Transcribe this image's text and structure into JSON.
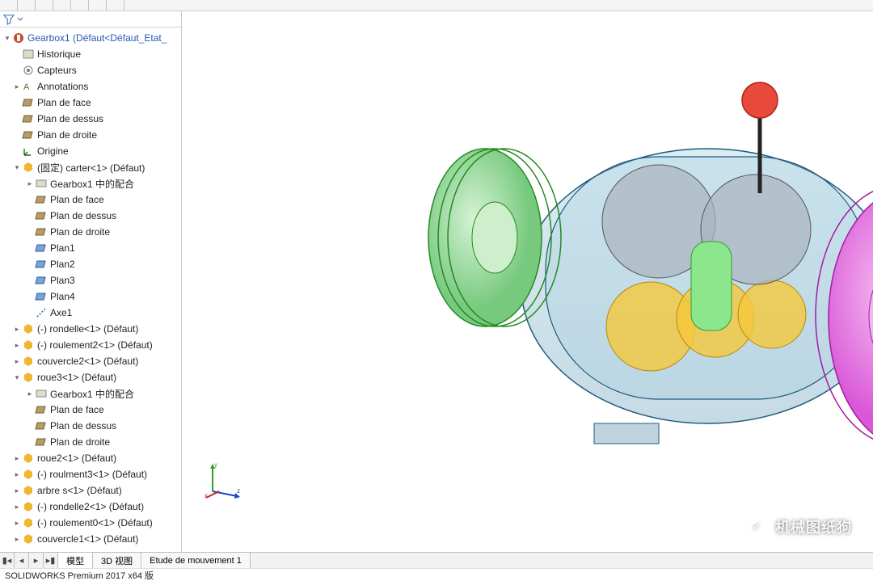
{
  "tree": {
    "root": "Gearbox1  (Défaut<Défaut_Etat_",
    "history": "Historique",
    "sensors": "Capteurs",
    "annotations": "Annotations",
    "plane_face": "Plan de face",
    "plane_top": "Plan de dessus",
    "plane_right": "Plan de droite",
    "origin": "Origine",
    "carter": "(固定) carter<1> (Défaut)",
    "mates1": "Gearbox1 中的配合",
    "plan1": "Plan1",
    "plan2": "Plan2",
    "plan3": "Plan3",
    "plan4": "Plan4",
    "axe1": "Axe1",
    "rondelle1": "(-) rondelle<1> (Défaut)",
    "roulement2_1": "(-) roulement2<1> (Défaut)",
    "couvercle2_1": "couvercle2<1> (Défaut)",
    "roue3_1": "roue3<1> (Défaut)",
    "mates2": "Gearbox1 中的配合",
    "roue2_1": "roue2<1> (Défaut)",
    "roulment3_1": "(-) roulment3<1> (Défaut)",
    "arbre_s1": "arbre s<1> (Défaut)",
    "rondelle2_1": "(-) rondelle2<1> (Défaut)",
    "roulement0_1": "(-) roulement0<1> (Défaut)",
    "couvercle1_1": "couvercle1<1> (Défaut)"
  },
  "tabs": {
    "model": "模型",
    "view3d": "3D 视图",
    "motion": "Etude de mouvement 1"
  },
  "status": "SOLIDWORKS Premium 2017 x64 版",
  "watermark": "机械图纸狗",
  "triad": {
    "x": "x",
    "y": "y",
    "z": "z"
  }
}
